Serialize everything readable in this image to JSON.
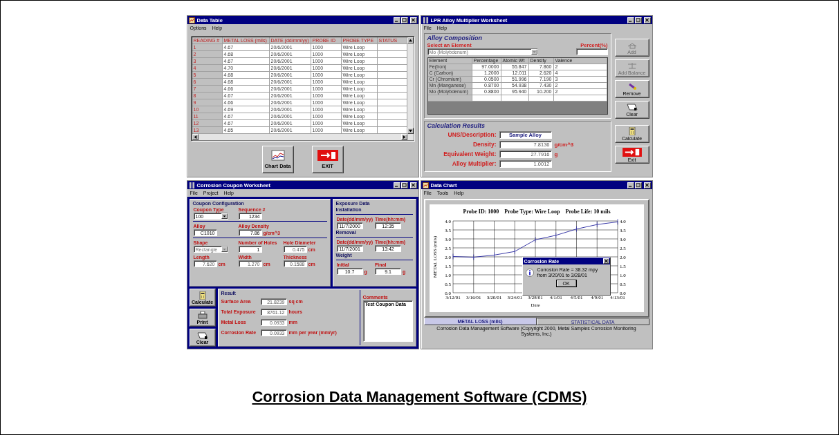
{
  "data_table": {
    "title": "Data Table",
    "menu": [
      "Options",
      "Help"
    ],
    "columns": [
      "READING #",
      "METAL LOSS (mils)",
      "DATE (dd/mm/yy)",
      "PROBE ID",
      "PROBE TYPE",
      "STATUS"
    ],
    "rows": [
      {
        "reading": "1",
        "metal_loss": "4.67",
        "date": "20/6/2001",
        "probe_id": "1000",
        "probe_type": "Wire Loop"
      },
      {
        "reading": "2",
        "metal_loss": "4.68",
        "date": "20/6/2001",
        "probe_id": "1000",
        "probe_type": "Wire Loop"
      },
      {
        "reading": "3",
        "metal_loss": "4.67",
        "date": "20/6/2001",
        "probe_id": "1000",
        "probe_type": "Wire Loop"
      },
      {
        "reading": "4",
        "metal_loss": "4.70",
        "date": "20/6/2001",
        "probe_id": "1000",
        "probe_type": "Wire Loop"
      },
      {
        "reading": "5",
        "metal_loss": "4.68",
        "date": "20/6/2001",
        "probe_id": "1000",
        "probe_type": "Wire Loop"
      },
      {
        "reading": "6",
        "metal_loss": "4.68",
        "date": "20/6/2001",
        "probe_id": "1000",
        "probe_type": "Wire Loop"
      },
      {
        "reading": "7",
        "metal_loss": "4.66",
        "date": "20/6/2001",
        "probe_id": "1000",
        "probe_type": "Wire Loop"
      },
      {
        "reading": "8",
        "metal_loss": "4.67",
        "date": "20/6/2001",
        "probe_id": "1000",
        "probe_type": "Wire Loop"
      },
      {
        "reading": "9",
        "metal_loss": "4.66",
        "date": "20/6/2001",
        "probe_id": "1000",
        "probe_type": "Wire Loop"
      },
      {
        "reading": "10",
        "metal_loss": "4.69",
        "date": "20/6/2001",
        "probe_id": "1000",
        "probe_type": "Wire Loop"
      },
      {
        "reading": "11",
        "metal_loss": "4.67",
        "date": "20/6/2001",
        "probe_id": "1000",
        "probe_type": "Wire Loop"
      },
      {
        "reading": "12",
        "metal_loss": "4.67",
        "date": "20/6/2001",
        "probe_id": "1000",
        "probe_type": "Wire Loop"
      },
      {
        "reading": "13",
        "metal_loss": "4.65",
        "date": "20/6/2001",
        "probe_id": "1000",
        "probe_type": "Wire Loop"
      }
    ],
    "buttons": [
      {
        "label": "Chart Data",
        "kind": "chart"
      },
      {
        "label": "EXIT",
        "kind": "exit"
      }
    ]
  },
  "alloy_worksheet": {
    "title": "LPR Alloy Multiplier Worksheet",
    "menu": [
      "File",
      "Help"
    ],
    "composition_title": "Alloy Composition",
    "select_label": "Select an Element",
    "select_value": "Mo (Molybdenum)",
    "select_disabled": true,
    "percent_label": "Percent(%)",
    "columns": [
      "Element",
      "Percentage",
      "Atomic Wt",
      "Density",
      "Valence"
    ],
    "rows": [
      [
        "Fe(Iron)",
        "97.0000",
        "55.847",
        "7.860",
        "2"
      ],
      [
        "C (Carbon)",
        "1.2000",
        "12.011",
        "2.620",
        "4"
      ],
      [
        "Cr (Chromium)",
        "0.0500",
        "51.996",
        "7.190",
        "3"
      ],
      [
        "Mn (Manganese)",
        "0.8700",
        "54.938",
        "7.430",
        "2"
      ],
      [
        "Mo (Molybdenum)",
        "0.8800",
        "95.940",
        "10.200",
        "2"
      ]
    ],
    "side_buttons": [
      {
        "label": "Add",
        "kind": "add",
        "disabled": true
      },
      {
        "label": "Add Balance",
        "kind": "balance",
        "disabled": true
      },
      {
        "label": "Remove",
        "kind": "remove",
        "disabled": false
      },
      {
        "label": "Clear",
        "kind": "clear",
        "disabled": false
      }
    ],
    "results_title": "Calculation Results",
    "results": [
      {
        "label": "UNS/Description:",
        "value": "Sample Alloy",
        "disabled": false
      },
      {
        "label": "Density:",
        "value": "7.8136",
        "unit": "g/cm^3",
        "disabled": true
      },
      {
        "label": "Equivalent Weight:",
        "value": "27.7916",
        "unit": "g",
        "disabled": true
      },
      {
        "label": "Alloy Multiplier:",
        "value": "1.0012",
        "disabled": true
      }
    ],
    "result_buttons": [
      {
        "label": "Calculate",
        "kind": "calculate"
      },
      {
        "label": "Exit",
        "kind": "exit"
      }
    ]
  },
  "coupon_worksheet": {
    "title": "Corrosion Coupon Worksheet",
    "menu": [
      "File",
      "Project",
      "Help"
    ],
    "configuration": {
      "title": "Coupon Configuration",
      "groups": [
        [
          [
            {
              "label": "Coupon Type",
              "value": "100",
              "kind": "select",
              "disabled": false
            },
            {
              "label": "Sequence #",
              "value": "1234",
              "kind": "input",
              "disabled": false
            }
          ]
        ],
        [
          [
            {
              "label": "Alloy",
              "value": "C1010",
              "kind": "input",
              "disabled": false
            },
            {
              "label": "Alloy Density",
              "value": "7.86",
              "unit": "g/cm^3",
              "kind": "input",
              "disabled": false
            }
          ]
        ],
        [
          [
            {
              "label": "Shape",
              "value": "Rectangle",
              "kind": "select",
              "disabled": true
            },
            {
              "label": "Number of Holes",
              "value": "1",
              "kind": "input",
              "disabled": false
            },
            {
              "label": "Hole Diameter",
              "value": "0.475",
              "unit": "cm",
              "kind": "input",
              "disabled": true
            }
          ],
          [
            {
              "label": "Length",
              "value": "7.620",
              "unit": "cm",
              "kind": "input",
              "disabled": true
            },
            {
              "label": "Width",
              "value": "1.270",
              "unit": "cm",
              "kind": "input",
              "disabled": true
            },
            {
              "label": "Thickness",
              "value": "0.1588",
              "unit": "cm",
              "kind": "input",
              "disabled": true
            }
          ]
        ]
      ]
    },
    "exposure": {
      "title": "Exposure Data",
      "sections": [
        {
          "title": "Installation",
          "fields": [
            {
              "label": "Date(dd/mm/yy)",
              "value": "11/7/2000"
            },
            {
              "label": "Time(hh:mm)",
              "value": "12:35"
            }
          ]
        },
        {
          "title": "Removal",
          "fields": [
            {
              "label": "Date(dd/mm/yy)",
              "value": "11/7/2001"
            },
            {
              "label": "Time(hh:mm)",
              "value": "13:42"
            }
          ]
        },
        {
          "title": "Weight",
          "fields": [
            {
              "label": "Initial",
              "value": "10.7",
              "unit": "g"
            },
            {
              "label": "Final",
              "value": "9.1",
              "unit": "g"
            }
          ]
        }
      ]
    },
    "side_buttons": [
      {
        "label": "Calculate",
        "kind": "calculate"
      },
      {
        "label": "Print",
        "kind": "print"
      },
      {
        "label": "Clear",
        "kind": "clear"
      }
    ],
    "result": {
      "title": "Result",
      "fields": [
        {
          "label": "Surface Area",
          "value": "21.8239",
          "unit": "sq cm"
        },
        {
          "label": "Total Exposure",
          "value": "8761.12",
          "unit": "hours"
        },
        {
          "label": "Metal Loss",
          "value": "0.0933",
          "unit": "mm"
        },
        {
          "label": "Corrosion Rate",
          "value": "0.0933",
          "unit": "mm per year (mm/yr)"
        }
      ]
    },
    "comments": {
      "label": "Comments",
      "value": "Test Coupon Data"
    }
  },
  "data_chart": {
    "title": "Data Chart",
    "menu": [
      "File",
      "Tools",
      "Help"
    ],
    "chart_data": {
      "type": "line",
      "title": "Probe ID: 1000    Probe Type: Wire Loop    Probe Life: 10 mils",
      "xlabel": "Date",
      "ylabel": "METAL LOSS (mils)",
      "categories": [
        "3/12/01",
        "3/16/01",
        "3/20/01",
        "3/24/01",
        "3/28/01",
        "4/1/01",
        "4/5/01",
        "4/9/01",
        "4/13/01"
      ],
      "grid": true,
      "series": [
        {
          "color": "#3a3aa8",
          "values": [
            2.02,
            1.98,
            2.1,
            2.3,
            2.95,
            3.2,
            3.55,
            3.8,
            3.95
          ]
        }
      ],
      "ylim": [
        0,
        4
      ],
      "yticks": [
        {
          "value": 0,
          "label": "0.0"
        },
        {
          "value": 0.5,
          "label": "0.5"
        },
        {
          "value": 1,
          "label": "1.0"
        },
        {
          "value": 1.5,
          "label": "1.5"
        },
        {
          "value": 2,
          "label": "2.0"
        },
        {
          "value": 2.5,
          "label": "2.5"
        },
        {
          "value": 3,
          "label": "3.0"
        },
        {
          "value": 3.5,
          "label": "3.5"
        },
        {
          "value": 4,
          "label": "4.0"
        }
      ]
    },
    "dialog": {
      "title": "Corrosion Rate",
      "lines": [
        "Corrosion Rate = 38.32 mpy",
        "from 3/20/01 to 3/28/01"
      ],
      "button": "OK"
    },
    "tabs": [
      {
        "label": "METAL LOSS (mils)",
        "selected": true
      },
      {
        "label": "STATISTICAL DATA",
        "selected": false
      }
    ],
    "footer": "Corrosion Data Management Software (Copyright 2000, Metal Samples Corrosion Monitoring Systems, Inc.)"
  },
  "caption": "Corrosion Data Management Software (CDMS)"
}
